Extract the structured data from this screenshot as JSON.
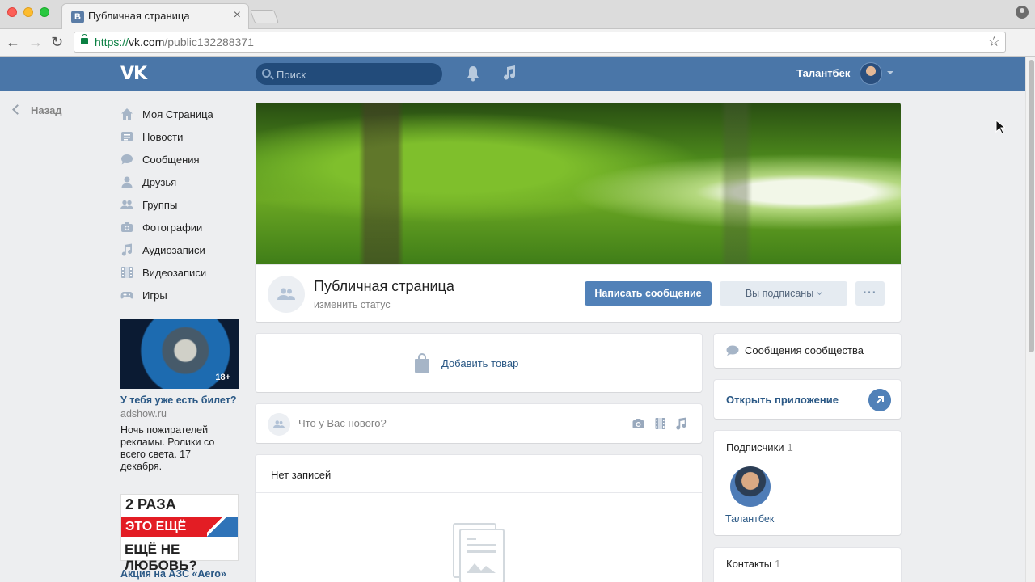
{
  "browser": {
    "tab_title": "Публичная страница",
    "tab_favicon": "В",
    "tab_close": "×",
    "url_scheme": "https://",
    "url_host": "vk.com",
    "url_path": "/public132288371",
    "back_glyph": "←",
    "forward_glyph": "→",
    "reload_glyph": "↻",
    "star_glyph": "☆",
    "menu_glyph": "⋮"
  },
  "header": {
    "logo": "VK",
    "search_placeholder": "Поиск",
    "user_name": "Талантбек",
    "brand_color": "#4a76a8"
  },
  "back": {
    "label": "Назад"
  },
  "left_menu": [
    {
      "label": "Моя Страница",
      "icon": "home-icon"
    },
    {
      "label": "Новости",
      "icon": "news-icon"
    },
    {
      "label": "Сообщения",
      "icon": "messages-icon"
    },
    {
      "label": "Друзья",
      "icon": "friends-icon"
    },
    {
      "label": "Группы",
      "icon": "groups-icon"
    },
    {
      "label": "Фотографии",
      "icon": "camera-icon"
    },
    {
      "label": "Аудиозаписи",
      "icon": "music-icon"
    },
    {
      "label": "Видеозаписи",
      "icon": "film-icon"
    },
    {
      "label": "Игры",
      "icon": "gamepad-icon"
    }
  ],
  "ads": [
    {
      "age": "18+",
      "title": "У тебя уже есть билет?",
      "domain": "adshow.ru",
      "text": "Ночь пожирателей рекламы. Ролики со всего света. 17 декабря."
    },
    {
      "line1": "2 РАЗА",
      "line2": "ЭТО ЕЩЁ",
      "line3": "ЕЩЁ НЕ ЛЮБОВЬ?",
      "title": "Акция на АЗС «Аеro»"
    }
  ],
  "group": {
    "name": "Публичная страница",
    "status": "изменить статус",
    "btn_message": "Написать сообщение",
    "btn_subscribed": "Вы подписаны",
    "btn_more": "···"
  },
  "add_product": {
    "label": "Добавить товар"
  },
  "composer": {
    "placeholder": "Что у Вас нового?"
  },
  "posts": {
    "header": "Нет записей"
  },
  "right": {
    "community_messages": "Сообщения сообщества",
    "open_app": "Открыть приложение",
    "subscribers_label": "Подписчики",
    "subscribers_count": "1",
    "subscriber_name": "Талантбек",
    "contacts_label": "Контакты",
    "contacts_count": "1"
  }
}
